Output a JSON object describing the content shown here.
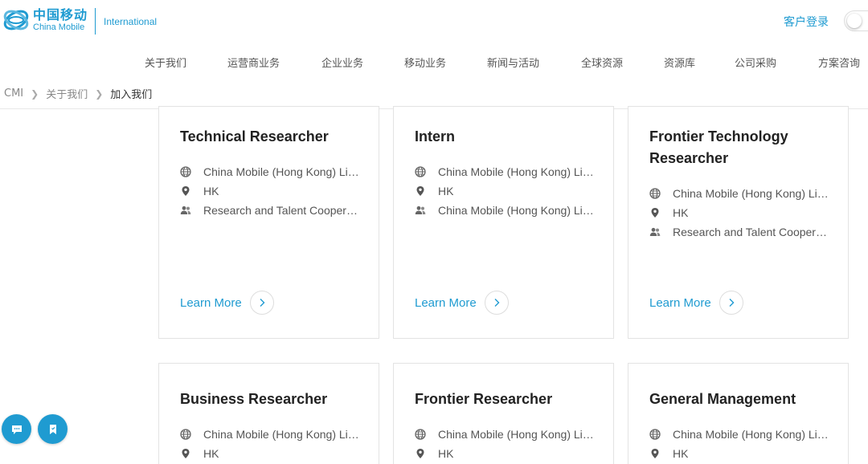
{
  "brand": {
    "name_cn": "中国移动",
    "name_en": "China Mobile",
    "suffix": "International",
    "color": "#1f9bd1",
    "icon": "china-mobile-logo"
  },
  "header": {
    "login_label": "客户登录",
    "toggle_icon": "toggle-switch"
  },
  "nav": {
    "items": [
      {
        "label": "关于我们"
      },
      {
        "label": "运营商业务"
      },
      {
        "label": "企业业务"
      },
      {
        "label": "移动业务"
      },
      {
        "label": "新闻与活动"
      },
      {
        "label": "全球资源"
      },
      {
        "label": "资源库"
      },
      {
        "label": "公司采购"
      },
      {
        "label": "方案咨询"
      }
    ]
  },
  "breadcrumb": {
    "items": [
      "CMI",
      "关于我们",
      "加入我们"
    ]
  },
  "jobs": {
    "learn_more_label": "Learn More",
    "icons": {
      "company": "globe-icon",
      "location": "location-pin-icon",
      "department": "people-icon",
      "learn_more": "chevron-right-icon"
    },
    "cards": [
      {
        "title": "Technical Researcher",
        "company": "China Mobile (Hong Kong) Limited",
        "location": "HK",
        "department": "Research and Talent Cooperation"
      },
      {
        "title": "Intern",
        "company": "China Mobile (Hong Kong) Limited",
        "location": "HK",
        "department": "China Mobile (Hong Kong) Limited"
      },
      {
        "title": "Frontier Technology Researcher",
        "company": "China Mobile (Hong Kong) Limited",
        "location": "HK",
        "department": "Research and Talent Cooperation"
      },
      {
        "title": "Business Researcher",
        "company": "China Mobile (Hong Kong) Limited",
        "location": "HK"
      },
      {
        "title": "Frontier Researcher",
        "company": "China Mobile (Hong Kong) Limited",
        "location": "HK"
      },
      {
        "title": "General Management",
        "company": "China Mobile (Hong Kong) Limited",
        "location": "HK"
      }
    ]
  },
  "floating": {
    "chat_icon": "chat-bubble-icon",
    "bookmark_icon": "bookmark-icon"
  }
}
